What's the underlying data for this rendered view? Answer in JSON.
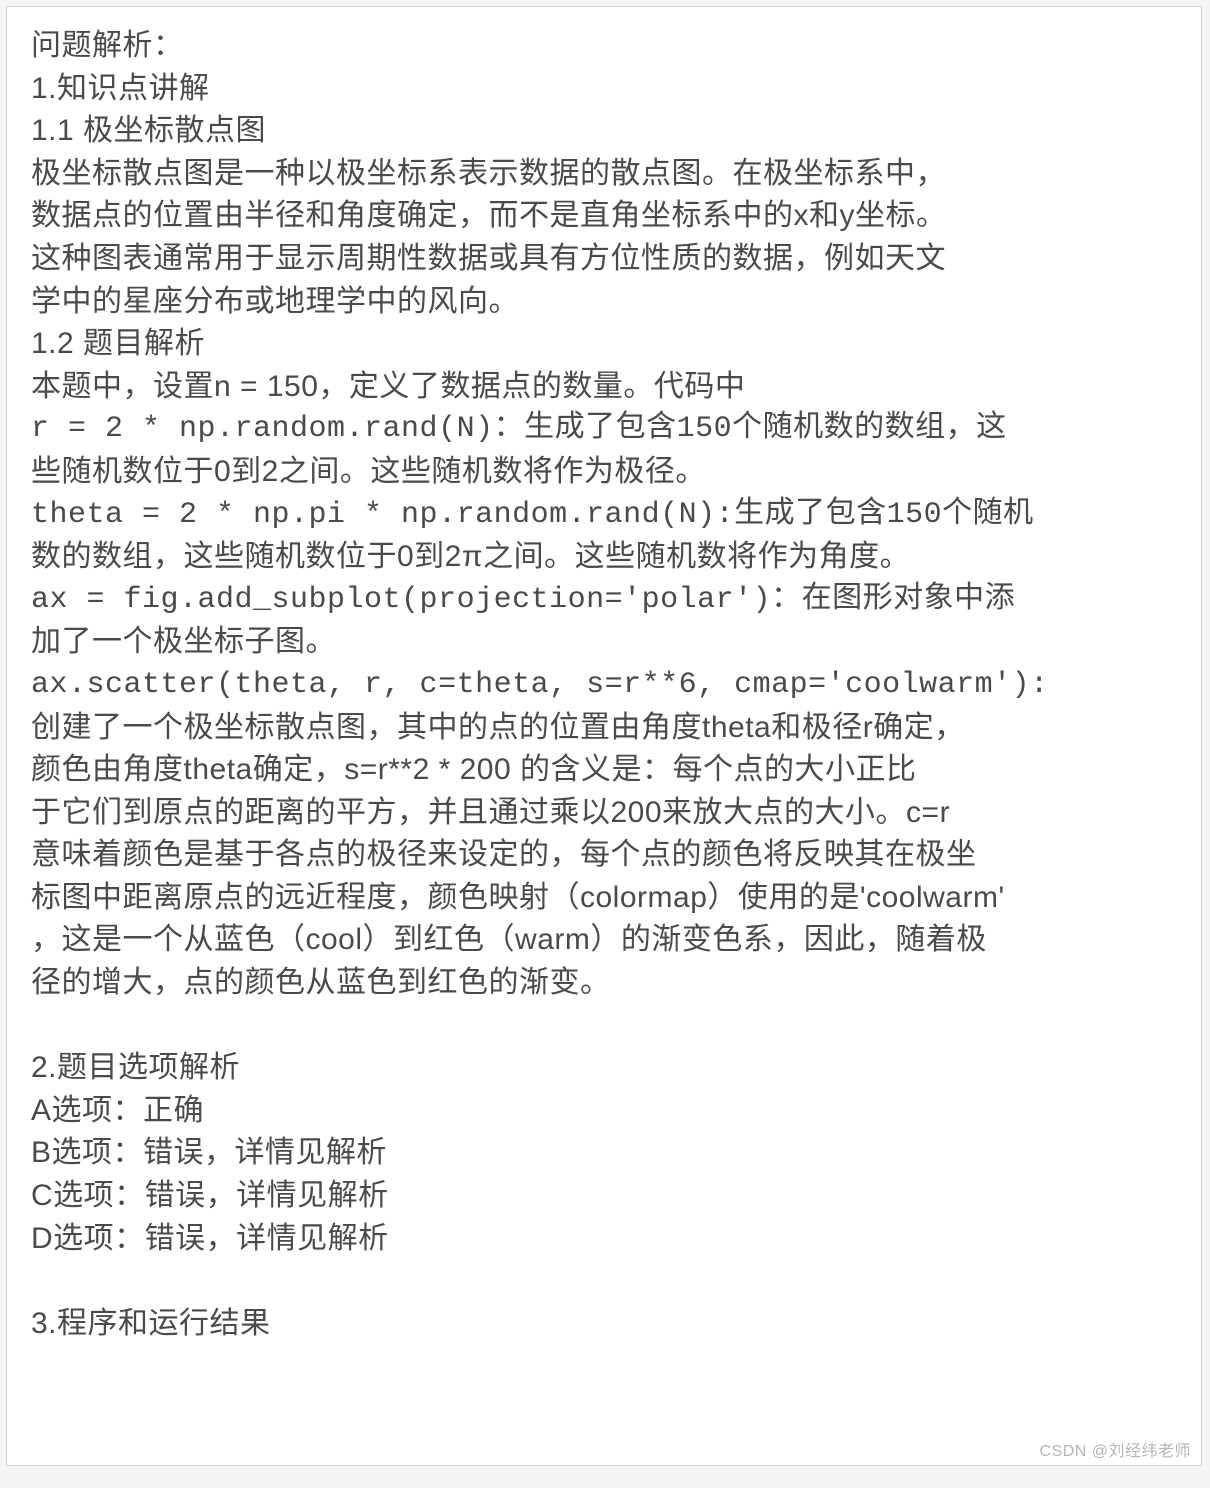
{
  "lines": {
    "l0": "问题解析：",
    "l1": "1.知识点讲解",
    "l2": "1.1 极坐标散点图",
    "l3": "极坐标散点图是一种以极坐标系表示数据的散点图。在极坐标系中，",
    "l4": "数据点的位置由半径和角度确定，而不是直角坐标系中的x和y坐标。",
    "l5": "这种图表通常用于显示周期性数据或具有方位性质的数据，例如天文",
    "l6": "学中的星座分布或地理学中的风向。",
    "l7": "1.2 题目解析",
    "l8": "本题中，设置n = 150，定义了数据点的数量。代码中",
    "l9": "r = 2 * np.random.rand(N)：生成了包含150个随机数的数组，这",
    "l10": "些随机数位于0到2之间。这些随机数将作为极径。",
    "l11": "theta = 2 * np.pi * np.random.rand(N):生成了包含150个随机",
    "l12": "数的数组，这些随机数位于0到2π之间。这些随机数将作为角度。",
    "l13": "ax = fig.add_subplot(projection='polar')：在图形对象中添",
    "l14": "加了一个极坐标子图。",
    "l15": "ax.scatter(theta, r, c=theta, s=r**6, cmap='coolwarm'):",
    "l16": "创建了一个极坐标散点图，其中的点的位置由角度theta和极径r确定，",
    "l17": "颜色由角度theta确定，s=r**2 * 200 的含义是：每个点的大小正比",
    "l18": "于它们到原点的距离的平方，并且通过乘以200来放大点的大小。c=r",
    "l19": "意味着颜色是基于各点的极径来设定的，每个点的颜色将反映其在极坐",
    "l20": "标图中距离原点的远近程度，颜色映射（colormap）使用的是'coolwarm'",
    "l21": "，这是一个从蓝色（cool）到红色（warm）的渐变色系，因此，随着极",
    "l22": "径的增大，点的颜色从蓝色到红色的渐变。",
    "l23": "",
    "l24": "2.题目选项解析",
    "l25": "A选项：正确",
    "l26": "B选项：错误，详情见解析",
    "l27": "C选项：错误，详情见解析",
    "l28": "D选项：错误，详情见解析",
    "l29": "",
    "l30": "3.程序和运行结果"
  },
  "watermark": "CSDN @刘经纬老师"
}
